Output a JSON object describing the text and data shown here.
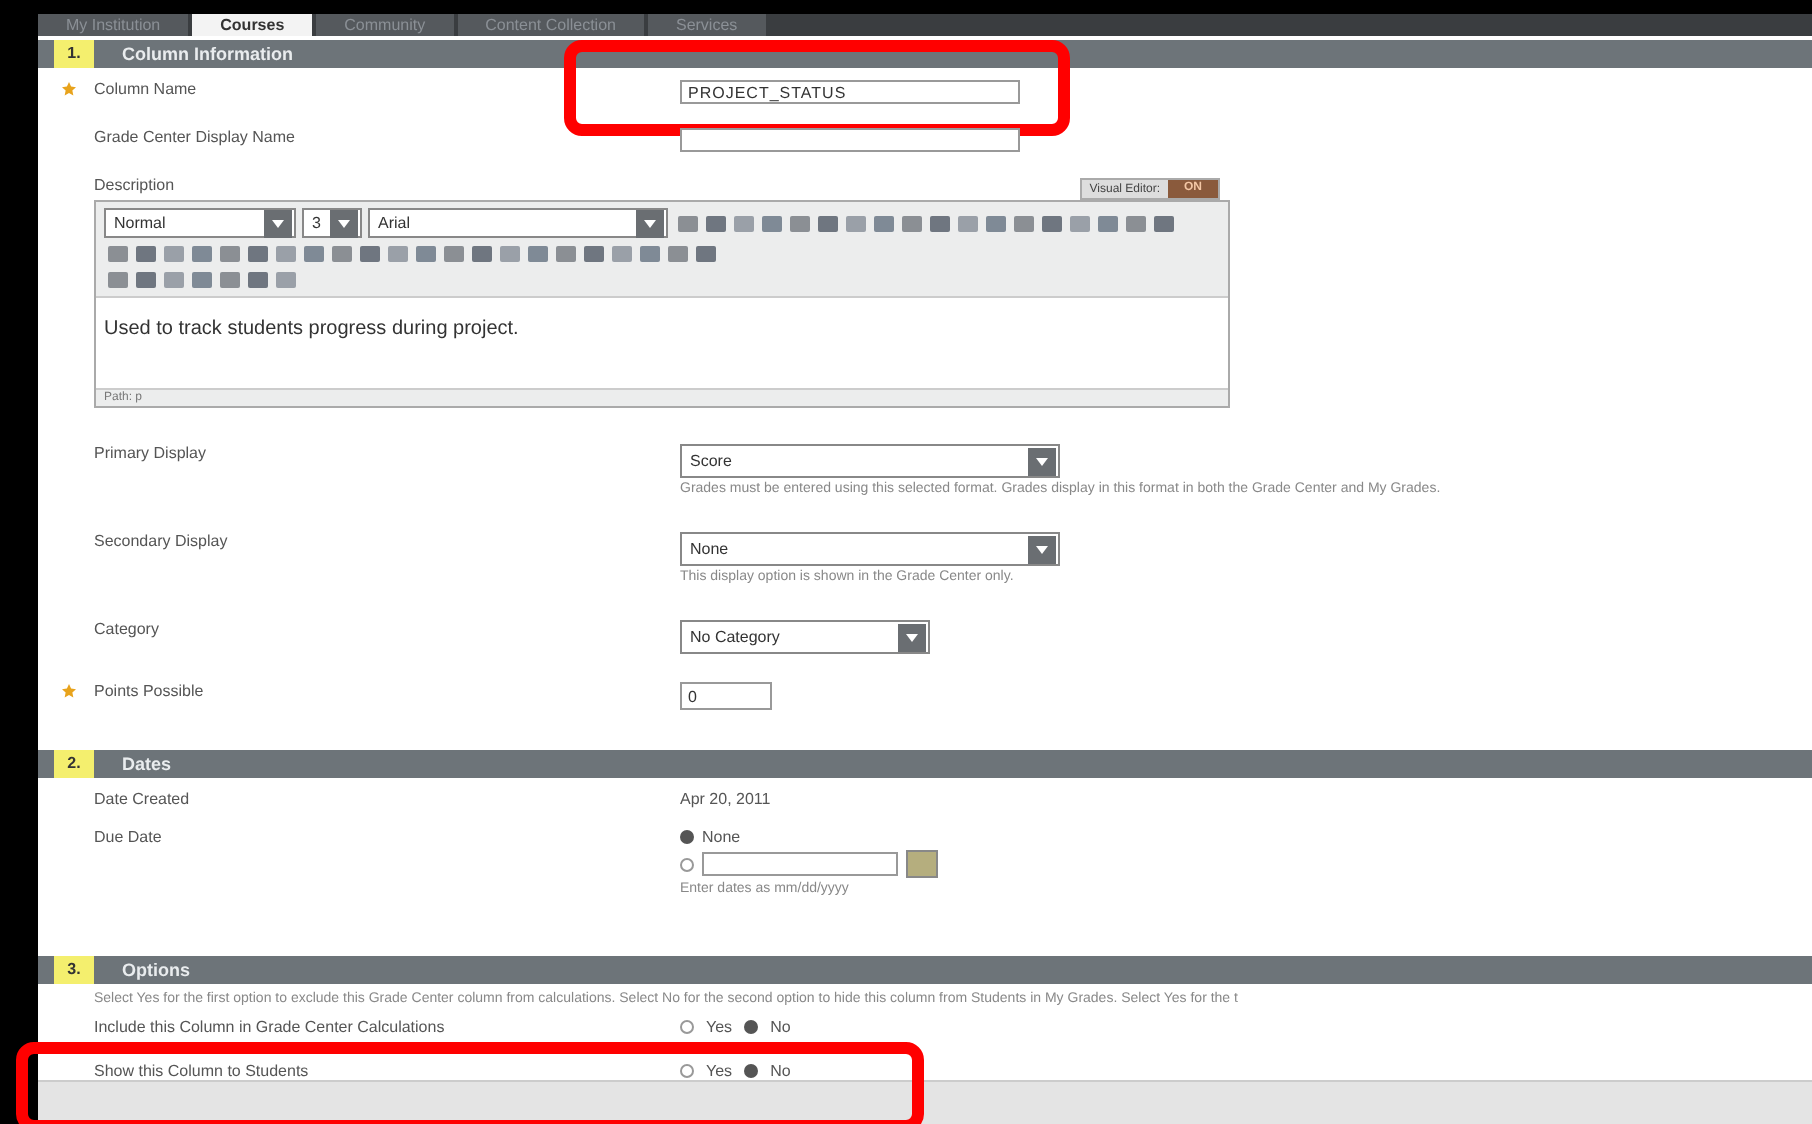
{
  "tabs": [
    {
      "label": "My Institution",
      "selected": false
    },
    {
      "label": "Courses",
      "selected": true
    },
    {
      "label": "Community",
      "selected": false
    },
    {
      "label": "Content Collection",
      "selected": false
    },
    {
      "label": "Services",
      "selected": false
    }
  ],
  "sections": [
    {
      "number": "1.",
      "title": "Column Information",
      "fields": [
        {
          "kind": "text",
          "label": "Column Name",
          "required": true,
          "value": "PROJECT_STATUS",
          "highlighted": true
        },
        {
          "kind": "text",
          "label": "Grade Center Display Name",
          "required": false,
          "highlighted": false
        },
        {
          "kind": "editor",
          "label": "Description",
          "visual_editor": {
            "label": "Visual Editor:",
            "state": "ON"
          },
          "font_style": "Normal",
          "font_size": "3",
          "font_family": "Arial",
          "content": "Used to track students progress during project.",
          "path": "Path: p"
        },
        {
          "kind": "select",
          "label": "Primary Display",
          "required": false,
          "value": "Score",
          "help": "Grades must be entered using this selected format. Grades display in this format in both the Grade Center and My Grades."
        },
        {
          "kind": "select",
          "label": "Secondary Display",
          "required": false,
          "value": "None",
          "help": "This display option is shown in the Grade Center only."
        },
        {
          "kind": "select",
          "label": "Category",
          "required": false,
          "value": "No Category"
        },
        {
          "kind": "short",
          "label": "Points Possible",
          "required": true,
          "value": "0",
          "highlighted": false
        }
      ]
    },
    {
      "number": "2.",
      "title": "Dates",
      "fields": [
        {
          "kind": "static",
          "label": "Date Created",
          "value": "Apr 20, 2011"
        },
        {
          "kind": "date",
          "label": "Due Date",
          "options": [
            {
              "label": "None",
              "selected": true
            },
            {
              "selected": false
            }
          ],
          "hint": "Enter dates as mm/dd/yyyy"
        }
      ]
    },
    {
      "number": "3.",
      "title": "Options",
      "instructions": "Select Yes for the first option to exclude this Grade Center column from calculations. Select No for the second option to hide this column from Students in My Grades. Select Yes for the t",
      "fields": [
        {
          "kind": "yesno",
          "label": "Include this Column in Grade Center Calculations",
          "options": [
            {
              "label": "Yes",
              "selected": false
            },
            {
              "label": "No",
              "selected": true
            }
          ],
          "highlighted": false
        },
        {
          "kind": "yesno",
          "label": "Show this Column to Students",
          "options": [
            {
              "label": "Yes",
              "selected": false
            },
            {
              "label": "No",
              "selected": true
            }
          ],
          "highlighted": true
        }
      ]
    }
  ]
}
